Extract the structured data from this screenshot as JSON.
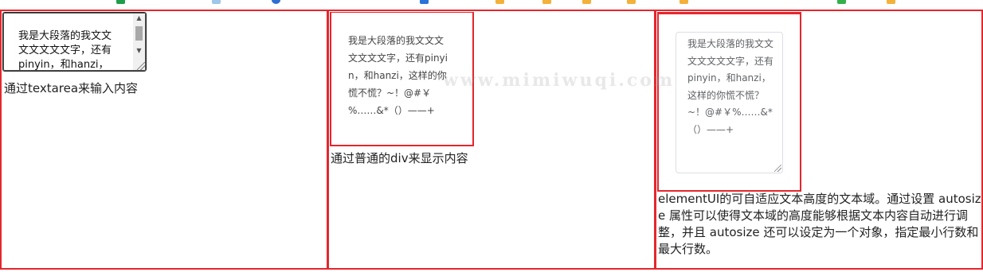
{
  "bookmarks": [
    {
      "icon": "green-bookmark-icon",
      "color": "#1e9e4a"
    },
    {
      "icon": "blue-page-icon",
      "color": "#9ec7ea"
    },
    {
      "icon": "blue-globe-icon",
      "color": "#2f6fd1"
    },
    {
      "icon": "blue-doc-icon",
      "color": "#2a73d8"
    },
    {
      "icon": "orange-folder-icon",
      "color": "#f3b13a"
    },
    {
      "icon": "orange-folder-icon",
      "color": "#f3b13a"
    },
    {
      "icon": "orange-folder-icon",
      "color": "#f3b13a"
    },
    {
      "icon": "orange-folder-icon",
      "color": "#f3b13a"
    },
    {
      "icon": "orange-folder-icon",
      "color": "#f3b13a"
    },
    {
      "icon": "green-app-icon",
      "color": "#33b04a"
    },
    {
      "icon": "orange-folder-icon",
      "color": "#f3b13a"
    }
  ],
  "colors": {
    "border_red": "#e5262d",
    "el_border": "#dcdfe6",
    "el_text": "#606266"
  },
  "sample_text": "我是大段落的我文文文文文文文字，还有pinyin，和hanzi，这样的你慌不慌？~！@#￥%……&*（）——+",
  "native_textarea": {
    "visible_text": "我是大段落的我文文文文文文文字，还有pinyin，和hanzi，这样的你慌",
    "caption": "通过textarea来输入内容"
  },
  "plain_div": {
    "caption": "通过普通的div来显示内容"
  },
  "el_textarea": {
    "caption": "elementUI的可自适应文本高度的文本域。通过设置 autosize 属性可以使得文本域的高度能够根据文本内容自动进行调整，并且 autosize 还可以设定为一个对象，指定最小行数和最大行数。"
  },
  "watermark": "www.mimiwuqi.com"
}
